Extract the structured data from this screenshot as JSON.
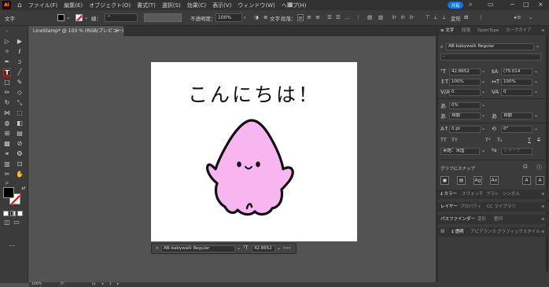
{
  "app": {
    "logo": "Ai",
    "menu": [
      "ファイル(F)",
      "編集(E)",
      "オブジェクト(O)",
      "書式(T)",
      "選択(S)",
      "効果(C)",
      "表示(V)",
      "ウィンドウ(W)",
      "ヘルプ(H)"
    ],
    "share_label": "共有",
    "accent_color": "#1473e6"
  },
  "control_bar": {
    "mode_label": "文字",
    "stroke_label": "線：",
    "opacity_label": "不透明度：",
    "opacity_value": "100%",
    "char_label": "文字",
    "paragraph_label": "段落：",
    "transform_label": "変形"
  },
  "document": {
    "tab_title": "LineStamp* @ 100 % (RGB/プレビュー)",
    "close_glyph": "×"
  },
  "artboard": {
    "text": "こんにちは！",
    "character_color": "#f7b6ef"
  },
  "context_bar": {
    "font": "AB-babywalk Regular",
    "size": "42.8652",
    "more": "•••"
  },
  "status_bar": {
    "zoom": "100%",
    "rotation": "0°",
    "page": "1"
  },
  "character_panel": {
    "tabs": [
      "文字",
      "段落",
      "OpenType",
      "カーブ"
    ],
    "font_family": "AB-babywalk Regular",
    "font_style": "-",
    "font_size": "42.8652",
    "leading": "(75.014",
    "vertical_scale": "100%",
    "horizontal_scale": "100%",
    "kerning": "0",
    "tracking": "0",
    "tsume": "0%",
    "aki_left": "自動",
    "aki_right": "自動",
    "baseline_shift": "0 pt",
    "rotation": "0°",
    "language": "英語：米国",
    "anti_alias": "シャープ"
  },
  "snap_section": {
    "title": "グリフにスナップ"
  },
  "panel_groups": [
    [
      "カラー",
      "スウォッチ",
      "ブラシ",
      "シンボル"
    ],
    [
      "レイヤー",
      "プロパティ",
      "CC ライブラリ"
    ],
    [
      "パスファインダー",
      "変形",
      "整列"
    ],
    [
      "線",
      "透明",
      "アピアランス",
      "グラフィックスタイル"
    ]
  ]
}
